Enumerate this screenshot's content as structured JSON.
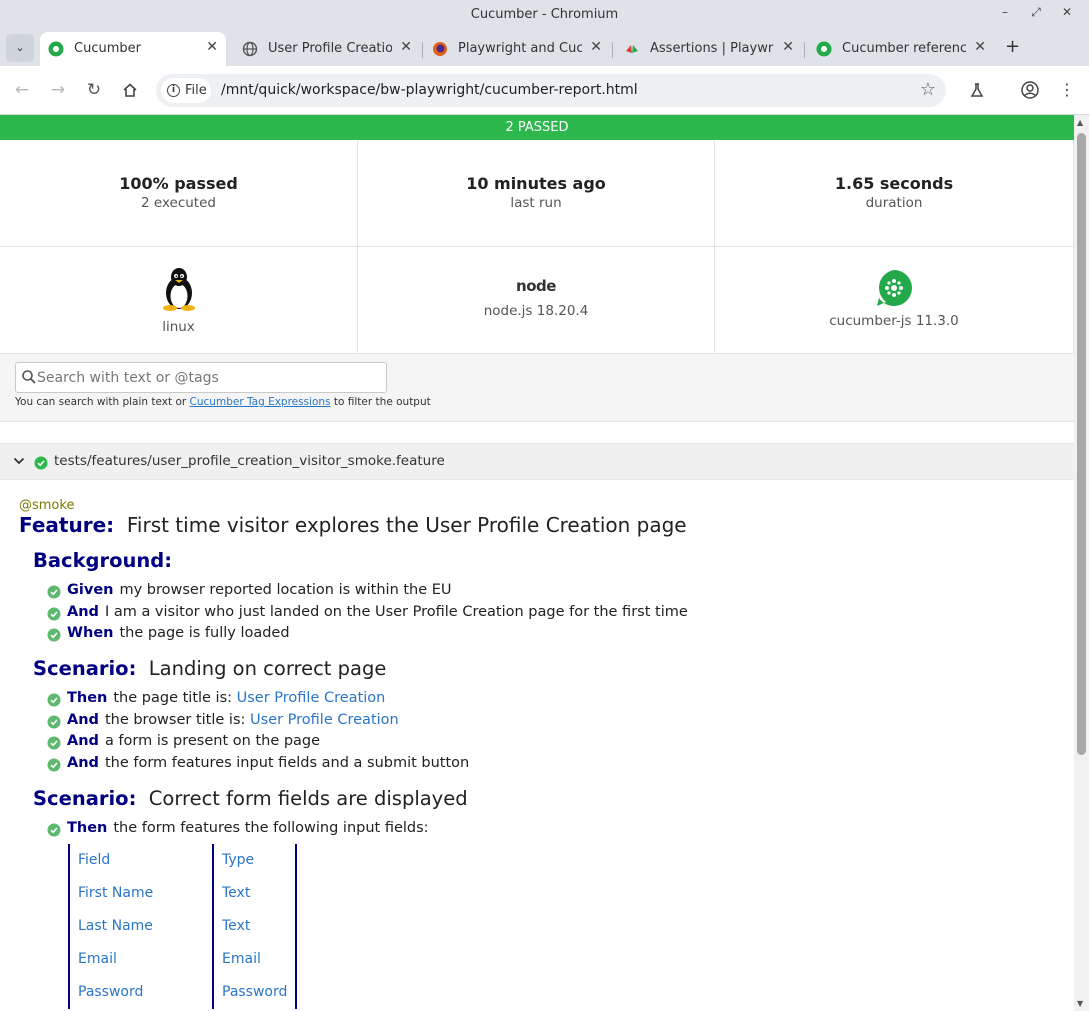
{
  "window": {
    "title": "Cucumber - Chromium"
  },
  "tabs": [
    {
      "label": "Cucumber",
      "active": true,
      "favicon": "cucumber-icon"
    },
    {
      "label": "User Profile Creation",
      "active": false,
      "favicon": "globe-icon"
    },
    {
      "label": "Playwright and Cucu",
      "active": false,
      "favicon": "firefox-icon"
    },
    {
      "label": "Assertions | Playwrig",
      "active": false,
      "favicon": "playwright-icon"
    },
    {
      "label": "Cucumber reference",
      "active": false,
      "favicon": "cucumber-icon"
    }
  ],
  "toolbar": {
    "chip_label": "File",
    "url": "/mnt/quick/workspace/bw-playwright/cucumber-report.html"
  },
  "report": {
    "banner": "2 PASSED",
    "stats": [
      {
        "big": "100% passed",
        "small": "2 executed"
      },
      {
        "big": "10 minutes ago",
        "small": "last run"
      },
      {
        "big": "1.65 seconds",
        "small": "duration"
      }
    ],
    "env": {
      "os": "linux",
      "runtime": "node.js 18.20.4",
      "runtime_logo": "node",
      "tool": "cucumber-js 11.3.0"
    },
    "search": {
      "placeholder": "Search with text or @tags",
      "hint_before": "You can search with plain text or ",
      "hint_link": "Cucumber Tag Expressions",
      "hint_after": " to filter the output"
    },
    "feature_file": "tests/features/user_profile_creation_visitor_smoke.feature",
    "tag": "@smoke",
    "feature": {
      "keyword": "Feature:",
      "name": "First time visitor explores the User Profile Creation page"
    },
    "background": {
      "keyword": "Background:",
      "steps": [
        {
          "kw": "Given",
          "text": "my browser reported location is within the EU"
        },
        {
          "kw": "And",
          "text": "I am a visitor who just landed on the User Profile Creation page for the first time"
        },
        {
          "kw": "When",
          "text": "the page is fully loaded"
        }
      ]
    },
    "scenario1": {
      "keyword": "Scenario:",
      "name": "Landing on correct page",
      "steps": [
        {
          "kw": "Then",
          "text": "the page title is: ",
          "param": "User Profile Creation"
        },
        {
          "kw": "And",
          "text": "the browser title is: ",
          "param": "User Profile Creation"
        },
        {
          "kw": "And",
          "text": "a form is present on the page"
        },
        {
          "kw": "And",
          "text": "the form features input fields and a submit button"
        }
      ]
    },
    "scenario2": {
      "keyword": "Scenario:",
      "name": "Correct form fields are displayed",
      "steps": [
        {
          "kw": "Then",
          "text": "the form features the following input fields:"
        }
      ],
      "table": [
        [
          "Field",
          "Type"
        ],
        [
          "First Name",
          "Text"
        ],
        [
          "Last Name",
          "Text"
        ],
        [
          "Email",
          "Email"
        ],
        [
          "Password",
          "Password"
        ]
      ]
    }
  },
  "colors": {
    "pass": "#2db84d",
    "keyword": "#000080",
    "link": "#2a76c6"
  }
}
